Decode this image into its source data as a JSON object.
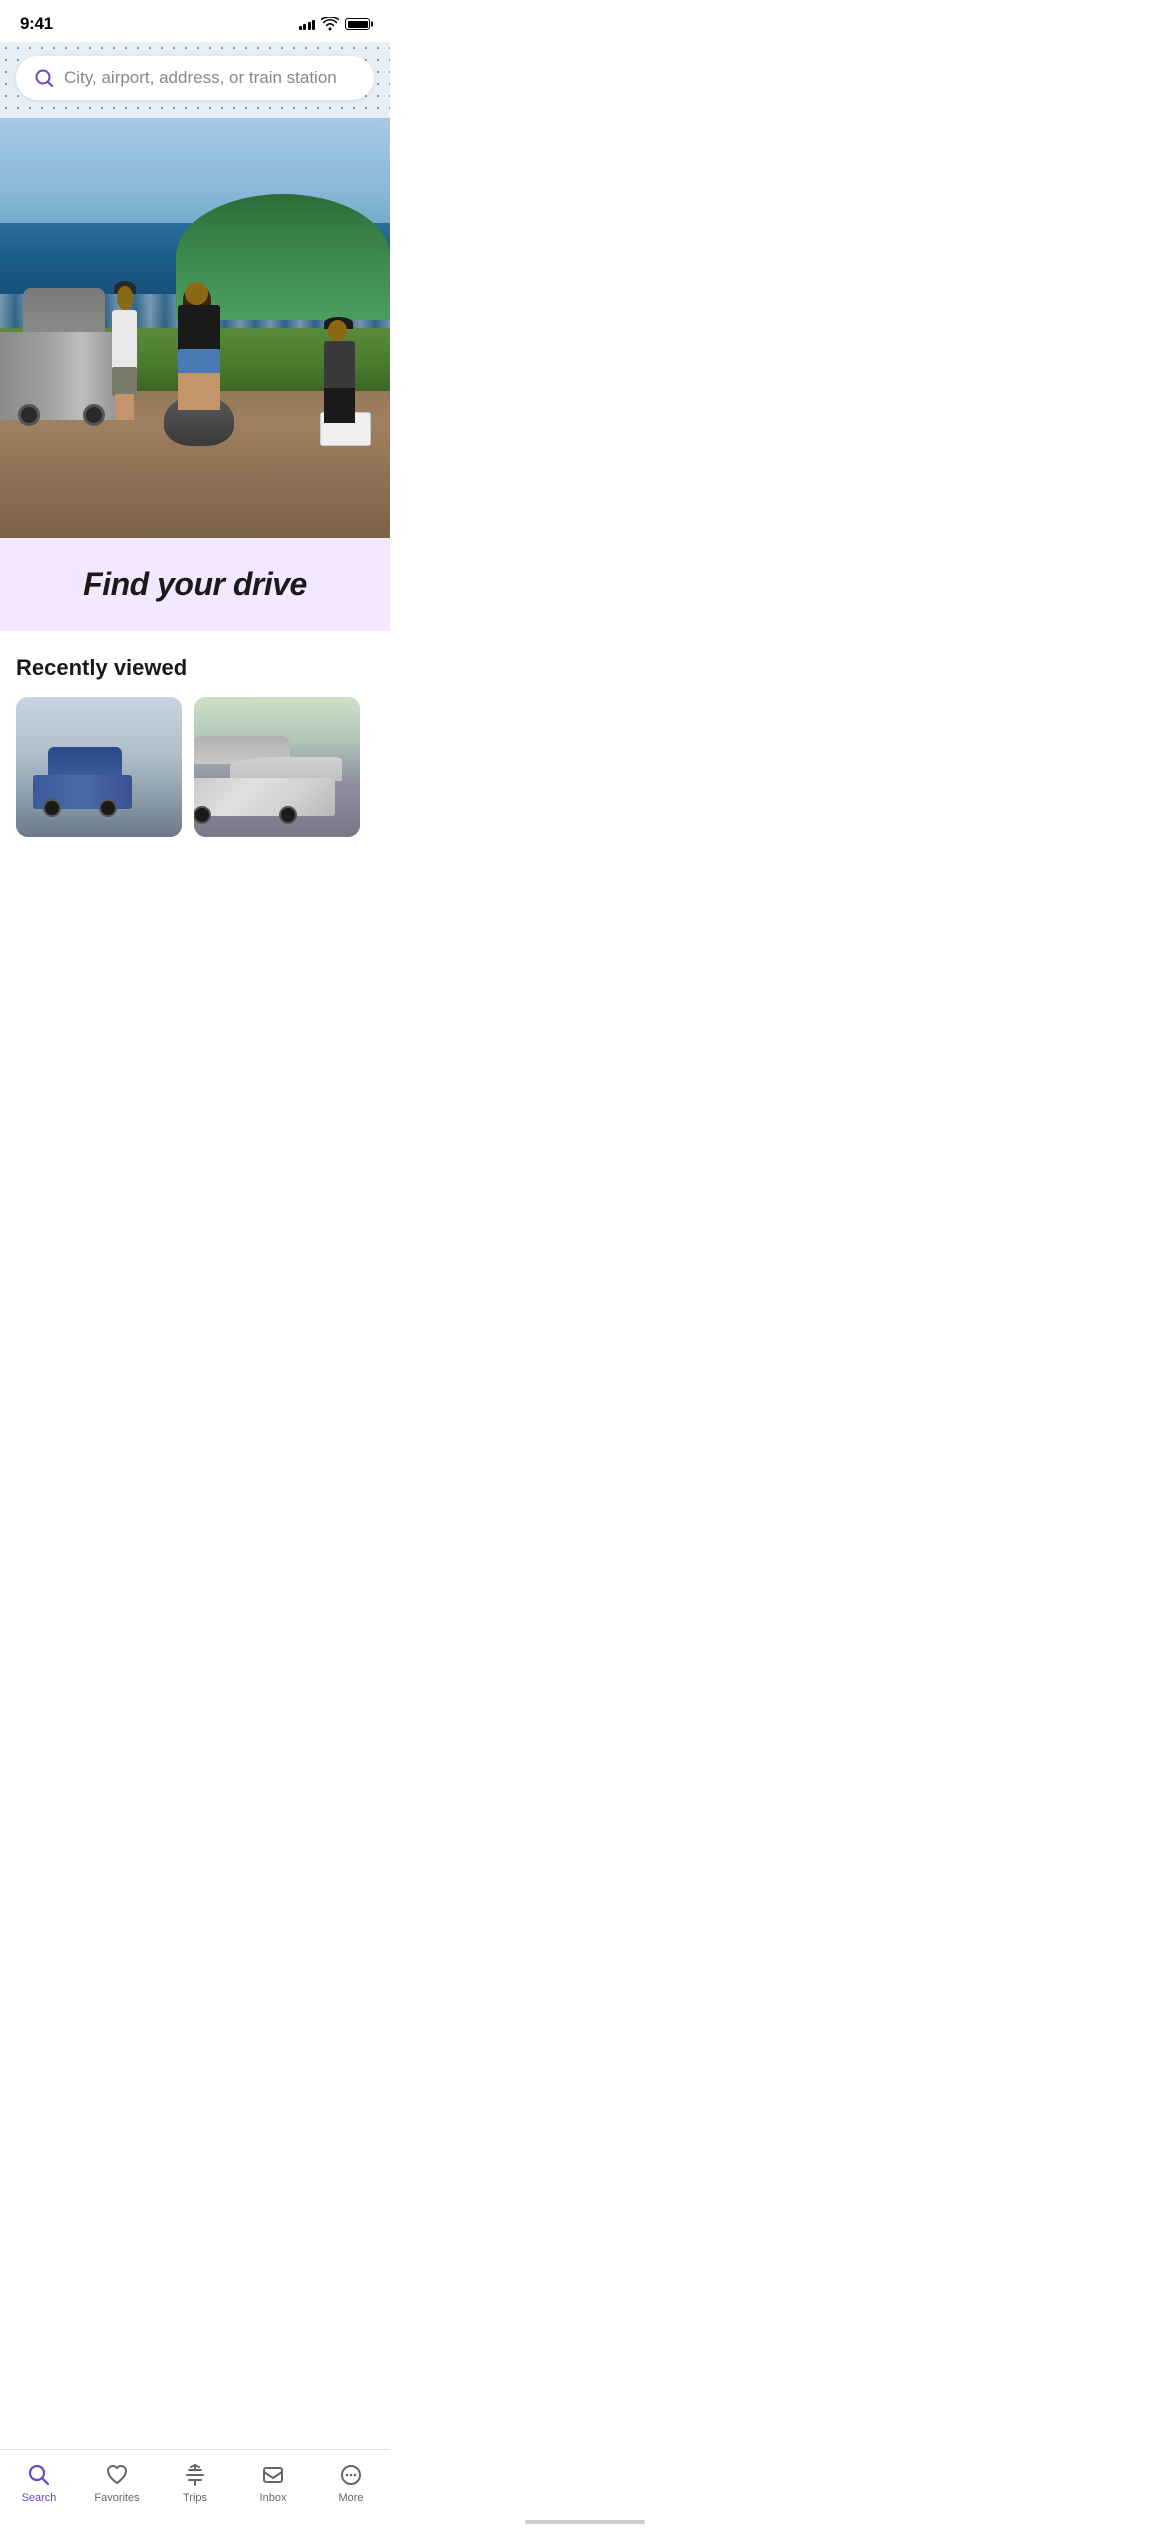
{
  "statusBar": {
    "time": "9:41",
    "signalBars": [
      4,
      6,
      8,
      10,
      12
    ],
    "batteryFull": true
  },
  "header": {
    "searchPlaceholder": "City, airport, address, or train station"
  },
  "hero": {
    "altText": "Three friends hanging out by a jeep at the beach"
  },
  "promoBanner": {
    "title": "Find your drive"
  },
  "recentlyViewed": {
    "sectionTitle": "Recently viewed",
    "cards": [
      {
        "id": "car-1",
        "altText": "Blue sedan parked on street"
      },
      {
        "id": "car-2",
        "altText": "Silver sedan in driveway"
      }
    ]
  },
  "bottomNav": {
    "items": [
      {
        "id": "search",
        "label": "Search",
        "active": true,
        "icon": "search-icon"
      },
      {
        "id": "favorites",
        "label": "Favorites",
        "active": false,
        "icon": "heart-icon"
      },
      {
        "id": "trips",
        "label": "Trips",
        "active": false,
        "icon": "trips-icon"
      },
      {
        "id": "inbox",
        "label": "Inbox",
        "active": false,
        "icon": "inbox-icon"
      },
      {
        "id": "more",
        "label": "More",
        "active": false,
        "icon": "more-icon"
      }
    ]
  }
}
